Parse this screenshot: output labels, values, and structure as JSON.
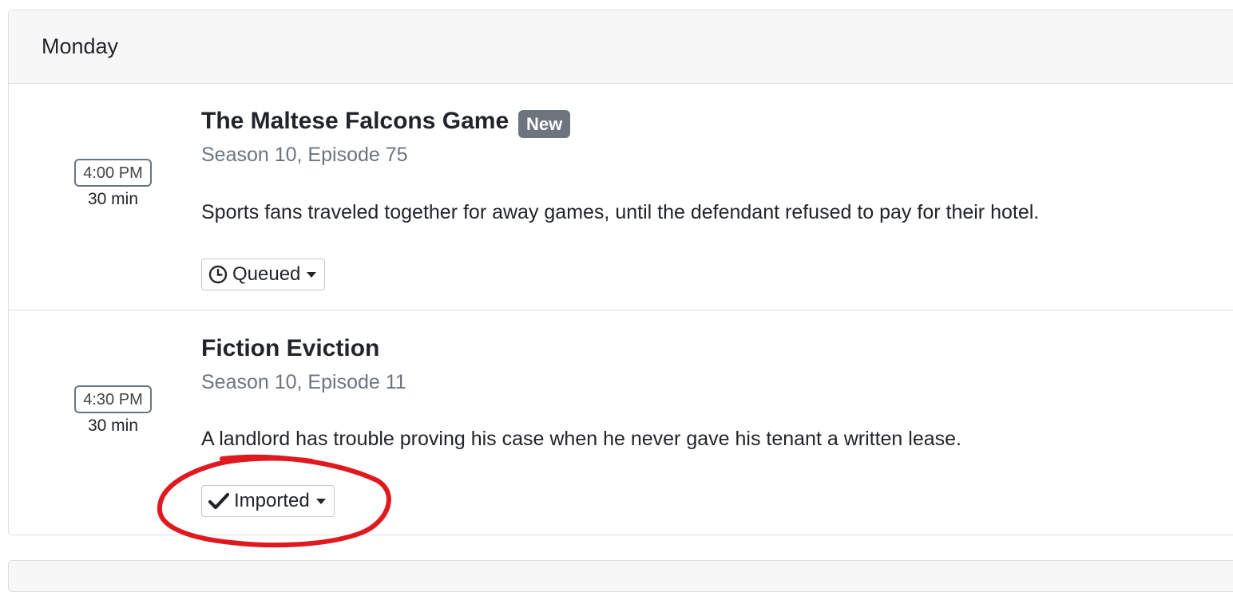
{
  "day": {
    "label": "Monday"
  },
  "episodes": [
    {
      "time": "4:00 PM",
      "duration": "30 min",
      "title": "The Maltese Falcons Game",
      "badge": "New",
      "subtitle": "Season 10, Episode 75",
      "description": "Sports fans traveled together for away games, until the defendant refused to pay for their hotel.",
      "status": {
        "label": "Queued",
        "icon": "clock-icon"
      }
    },
    {
      "time": "4:30 PM",
      "duration": "30 min",
      "title": "Fiction Eviction",
      "subtitle": "Season 10, Episode 11",
      "description": "A landlord has trouble proving his case when he never gave his tenant a written lease.",
      "status": {
        "label": "Imported",
        "icon": "checkmark-icon"
      }
    }
  ],
  "colors": {
    "header_bg": "#f7f7f7",
    "border": "#dfdfdf",
    "badge_bg": "#6c757d",
    "muted_text": "#6c757d",
    "annotation": "#e0191f"
  }
}
